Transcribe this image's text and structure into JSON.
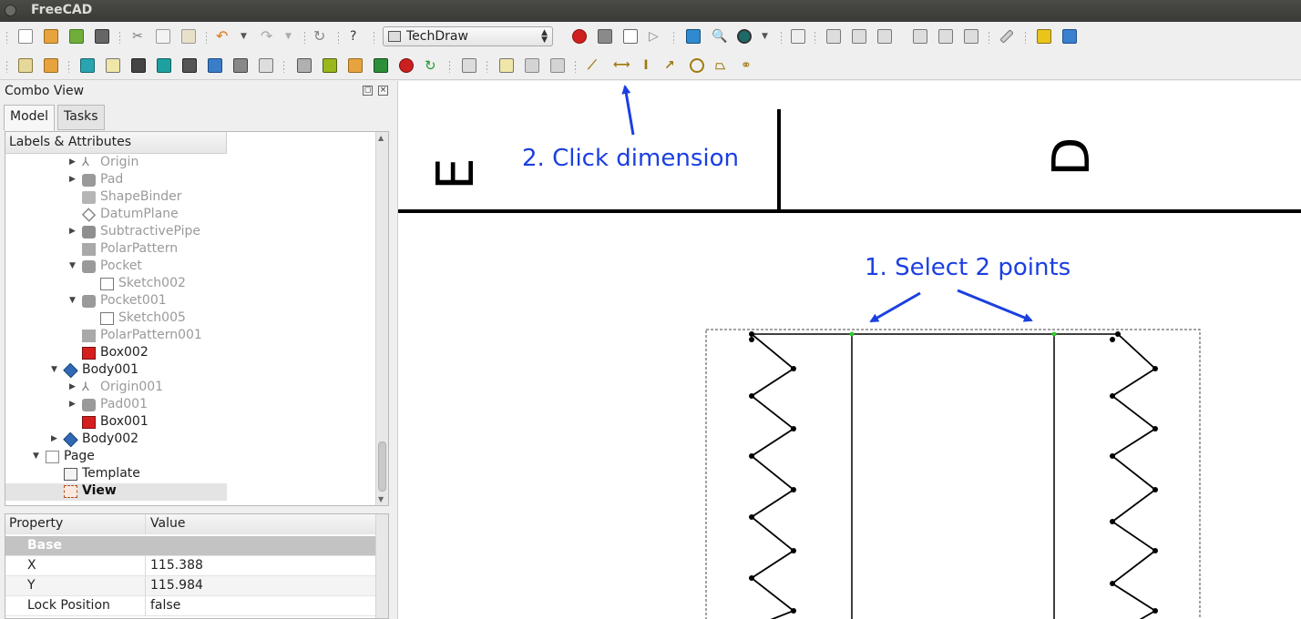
{
  "window": {
    "title": "FreeCAD"
  },
  "toolbar": {
    "workbench": "TechDraw"
  },
  "combo": {
    "title": "Combo View",
    "tabs": [
      "Model",
      "Tasks"
    ],
    "tree_header": "Labels & Attributes",
    "tree": [
      {
        "label": "Origin",
        "depth": 2,
        "expander": "closed",
        "icon": "origin-icon",
        "state": "hidden"
      },
      {
        "label": "Pad",
        "depth": 2,
        "expander": "closed",
        "icon": "pad-icon",
        "state": "hidden"
      },
      {
        "label": "ShapeBinder",
        "depth": 2,
        "expander": "none",
        "icon": "shapebinder-icon",
        "state": "hidden"
      },
      {
        "label": "DatumPlane",
        "depth": 2,
        "expander": "none",
        "icon": "datumplane-icon",
        "state": "hidden"
      },
      {
        "label": "SubtractivePipe",
        "depth": 2,
        "expander": "closed",
        "icon": "pipe-icon",
        "state": "hidden"
      },
      {
        "label": "PolarPattern",
        "depth": 2,
        "expander": "none",
        "icon": "polarpattern-icon",
        "state": "hidden"
      },
      {
        "label": "Pocket",
        "depth": 2,
        "expander": "open",
        "icon": "pocket-icon",
        "state": "hidden"
      },
      {
        "label": "Sketch002",
        "depth": 3,
        "expander": "none",
        "icon": "sketch-icon",
        "state": "hidden"
      },
      {
        "label": "Pocket001",
        "depth": 2,
        "expander": "open",
        "icon": "pocket-icon",
        "state": "hidden"
      },
      {
        "label": "Sketch005",
        "depth": 3,
        "expander": "none",
        "icon": "sketch-icon",
        "state": "hidden"
      },
      {
        "label": "PolarPattern001",
        "depth": 2,
        "expander": "none",
        "icon": "polarpattern-icon",
        "state": "hidden"
      },
      {
        "label": "Box002",
        "depth": 2,
        "expander": "none",
        "icon": "box-icon",
        "state": "normal"
      },
      {
        "label": "Body001",
        "depth": 1,
        "expander": "open",
        "icon": "body-icon",
        "state": "normal"
      },
      {
        "label": "Origin001",
        "depth": 2,
        "expander": "closed",
        "icon": "origin-icon",
        "state": "hidden"
      },
      {
        "label": "Pad001",
        "depth": 2,
        "expander": "closed",
        "icon": "pad-icon",
        "state": "hidden"
      },
      {
        "label": "Box001",
        "depth": 2,
        "expander": "none",
        "icon": "box-icon",
        "state": "normal"
      },
      {
        "label": "Body002",
        "depth": 1,
        "expander": "closed",
        "icon": "body-icon",
        "state": "normal"
      },
      {
        "label": "Page",
        "depth": 0,
        "expander": "open",
        "icon": "page-icon",
        "state": "normal"
      },
      {
        "label": "Template",
        "depth": 1,
        "expander": "none",
        "icon": "template-icon",
        "state": "normal"
      },
      {
        "label": "View",
        "depth": 1,
        "expander": "none",
        "icon": "view-icon",
        "state": "selected"
      }
    ],
    "props": {
      "col_property": "Property",
      "col_value": "Value",
      "group": "Base",
      "rows": [
        {
          "name": "X",
          "value": "115.388"
        },
        {
          "name": "Y",
          "value": "115.984"
        },
        {
          "name": "Lock Position",
          "value": "false"
        }
      ]
    }
  },
  "drawing": {
    "zone_left": "E",
    "zone_right": "D",
    "annotation_select": "1. Select 2 points",
    "annotation_click": "2. Click dimension",
    "annotation_color": "#1b3fe0"
  }
}
